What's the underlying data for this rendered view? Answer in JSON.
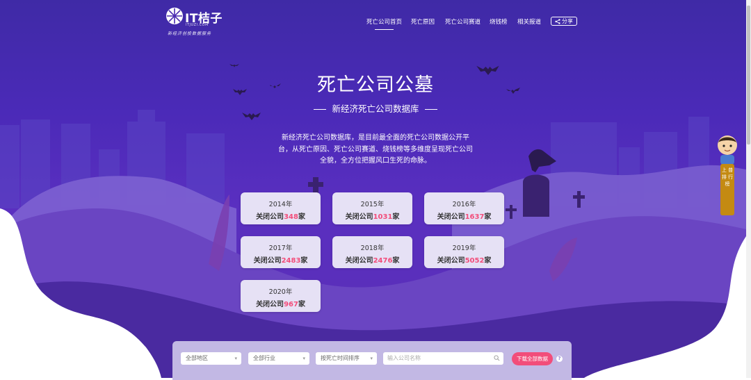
{
  "logo": {
    "name": "IT桔子",
    "sub": "ITJUZI.COM",
    "slogan": "新经济创投数据服务"
  },
  "nav": {
    "items": [
      {
        "label": "死亡公司首页",
        "active": true
      },
      {
        "label": "死亡原因",
        "active": false
      },
      {
        "label": "死亡公司赛道",
        "active": false
      },
      {
        "label": "烧钱榜",
        "active": false
      },
      {
        "label": "相关报道",
        "active": false
      }
    ],
    "share_label": "分享"
  },
  "hero": {
    "title": "死亡公司公墓",
    "subtitle": "新经济死亡公司数据库",
    "description": "新经济死亡公司数据库，是目前最全面的死亡公司数据公开平台，从死亡原因、死亡公司赛道、烧钱榜等多维度呈现死亡公司全貌，全方位把握风口生死的命脉。"
  },
  "years": [
    {
      "year": "2014年",
      "prefix": "关闭公司",
      "count": "348",
      "suffix": "家"
    },
    {
      "year": "2015年",
      "prefix": "关闭公司",
      "count": "1031",
      "suffix": "家"
    },
    {
      "year": "2016年",
      "prefix": "关闭公司",
      "count": "1637",
      "suffix": "家"
    },
    {
      "year": "2017年",
      "prefix": "关闭公司",
      "count": "2483",
      "suffix": "家"
    },
    {
      "year": "2018年",
      "prefix": "关闭公司",
      "count": "2476",
      "suffix": "家"
    },
    {
      "year": "2019年",
      "prefix": "关闭公司",
      "count": "5052",
      "suffix": "家"
    },
    {
      "year": "2020年",
      "prefix": "关闭公司",
      "count": "967",
      "suffix": "家"
    }
  ],
  "side_tab": {
    "label": "上 普 排 行 榜"
  },
  "filters": {
    "region": "全部地区",
    "industry": "全部行业",
    "sort": "按死亡时间排序",
    "search_placeholder": "输入公司名称",
    "download_label": "下载全部数据",
    "help": "?"
  },
  "colors": {
    "accent": "#f24d7a",
    "bg_top": "#3f2aa6",
    "card": "#e6e1f5"
  }
}
